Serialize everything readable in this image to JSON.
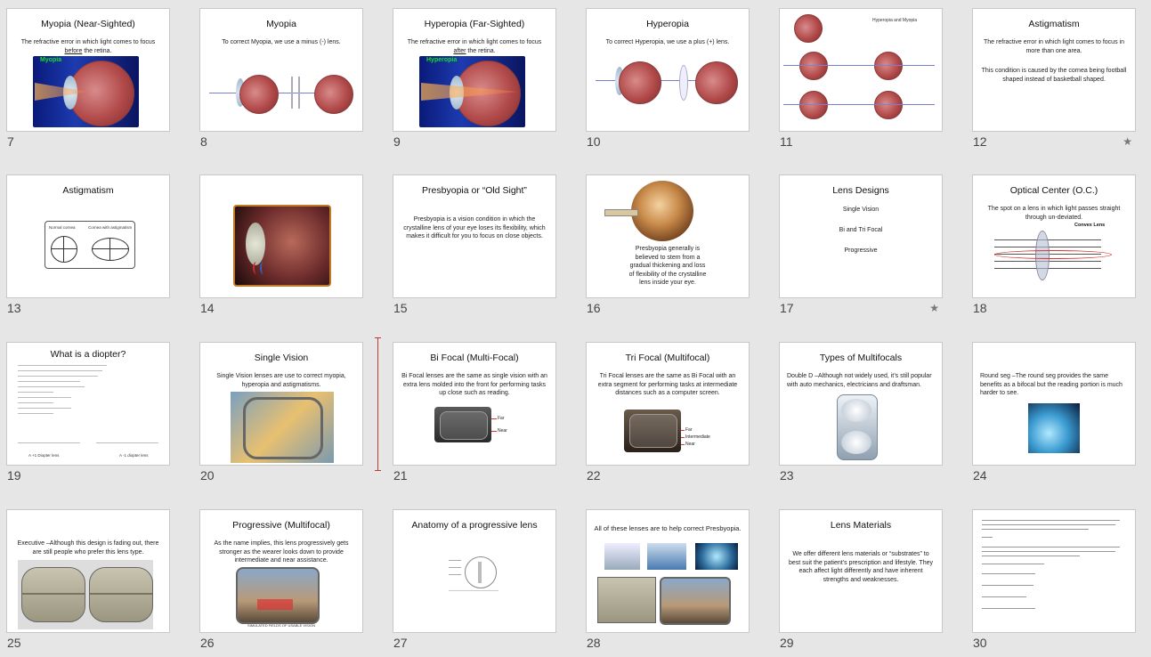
{
  "slides": [
    {
      "number": "7",
      "title": "Myopia (Near-Sighted)",
      "body_pre": "The refractive error in which light comes to focus ",
      "body_u": "before",
      "body_post": " the retina.",
      "image_label": "Myopia",
      "starred": false
    },
    {
      "number": "8",
      "title": "Myopia",
      "body": "To correct Myopia, we use a minus (-) lens.",
      "starred": false
    },
    {
      "number": "9",
      "title": "Hyperopia (Far-Sighted)",
      "body_pre": "The refractive error in which light comes to focus ",
      "body_u": "after",
      "body_post": " the retina.",
      "image_label": "Hyperopia",
      "starred": false
    },
    {
      "number": "10",
      "title": "Hyperopia",
      "body": "To correct Hyperopia, we use a plus (+) lens.",
      "starred": false
    },
    {
      "number": "11",
      "title": "Hyperopia and Myopia",
      "starred": false
    },
    {
      "number": "12",
      "title": "Astigmatism",
      "body": "The refractive error in which light comes to focus in more than one area.",
      "body2": "This condition is caused by the cornea being football shaped instead of basketball shaped.",
      "starred": true
    },
    {
      "number": "13",
      "title": "Astigmatism",
      "label_a": "Normal cornea",
      "label_b": "Cornea with astigmatism",
      "starred": false
    },
    {
      "number": "14",
      "starred": false
    },
    {
      "number": "15",
      "title": "Presbyopia or “Old Sight”",
      "body": "Presbyopia is a vision condition in which the crystalline lens of your eye loses its flexibility, which makes it difficult for you to focus on close objects.",
      "starred": false
    },
    {
      "number": "16",
      "body": "Presbyopia generally is believed to stem from a gradual thickening and loss of flexibility of the crystalline lens inside your eye.",
      "starred": false
    },
    {
      "number": "17",
      "title": "Lens Designs",
      "items": [
        "Single Vision",
        "Bi and Tri Focal",
        "Progressive"
      ],
      "starred": true
    },
    {
      "number": "18",
      "title": "Optical Center (O.C.)",
      "body": "The spot on a lens in which light passes straight through un-deviated.",
      "image_label": "Convex Lens",
      "starred": false
    },
    {
      "number": "19",
      "title": "What is a diopter?",
      "footer_a": "A +1 Diopter lens",
      "footer_b": "A -1 diopter lens",
      "starred": false
    },
    {
      "number": "20",
      "title": "Single Vision",
      "body": "Single Vision lenses are use to correct myopia, hyperopia and astigmatisms.",
      "starred": false
    },
    {
      "number": "21",
      "title": "Bi Focal (Multi-Focal)",
      "body": "Bi Focal lenses are the same as single vision with an extra lens molded into the front for performing tasks up close such as reading.",
      "labels": [
        "Far",
        "Near"
      ],
      "starred": false
    },
    {
      "number": "22",
      "title": "Tri Focal (Multifocal)",
      "body": "Tri Focal lenses are the same as Bi Focal with an extra segment for performing tasks at intermediate distances such as a computer screen.",
      "labels": [
        "Far",
        "Intermediate",
        "Near"
      ],
      "starred": false
    },
    {
      "number": "23",
      "title": "Types of Multifocals",
      "body": "Double D –Although not widely used, it’s still popular with auto mechanics, electricians and draftsman.",
      "starred": false
    },
    {
      "number": "24",
      "body": "Round seg –The round seg provides the same benefits as a bifocal but the reading portion is much harder to see.",
      "starred": false
    },
    {
      "number": "25",
      "body": "Executive –Although this design is fading out, there are still people who prefer this lens type.",
      "starred": false
    },
    {
      "number": "26",
      "title": "Progressive (Multifocal)",
      "body": "As the name implies, this lens progressively gets stronger as the wearer looks down to provide intermediate and near assistance.",
      "caption": "SIMULATED FIELDS OF USABLE VISION",
      "starred": false
    },
    {
      "number": "27",
      "title": "Anatomy of a progressive lens",
      "starred": false
    },
    {
      "number": "28",
      "title": "All of these lenses are to help correct Presbyopia.",
      "starred": false
    },
    {
      "number": "29",
      "title": "Lens Materials",
      "body": "We offer different lens materials or “substrates” to best suit the patient’s prescription and lifestyle. They each affect light differently and have inherent strengths and weaknesses.",
      "starred": false
    },
    {
      "number": "30",
      "starred": false
    }
  ],
  "colors": {
    "background": "#e6e6e6",
    "slide_border": "#c8c8c8",
    "selection": "#c0392b",
    "label_green": "#19e01c",
    "label_red": "#d33"
  }
}
